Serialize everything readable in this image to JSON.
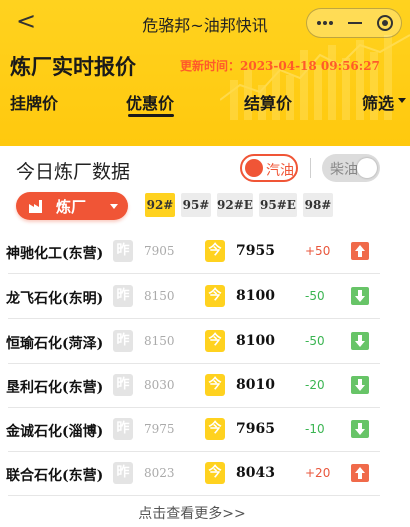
{
  "navbar": {
    "back_label": "<",
    "title": "危骆邦~油邦快讯"
  },
  "header": {
    "title": "炼厂实时报价",
    "update_time": "更新时间：2023-04-18 09:56:27"
  },
  "tabs": [
    {
      "label": "挂牌价",
      "active": false
    },
    {
      "label": "优惠价",
      "active": true
    },
    {
      "label": "结算价",
      "active": false
    },
    {
      "label": "筛选",
      "active": false
    }
  ],
  "section": {
    "title": "今日炼厂数据",
    "fuel_gasoline": "汽油",
    "fuel_diesel": "柴油",
    "selected_fuel": "汽油"
  },
  "refinery_select": {
    "label": "炼厂"
  },
  "grades": [
    {
      "label": "92#",
      "active": true
    },
    {
      "label": "95#",
      "active": false
    },
    {
      "label": "92#E",
      "active": false
    },
    {
      "label": "95#E",
      "active": false
    },
    {
      "label": "98#",
      "active": false
    }
  ],
  "badges": {
    "yesterday": "昨",
    "today": "今"
  },
  "rows": [
    {
      "name": "神驰化工(东营)",
      "yesterday": "7905",
      "today": "7955",
      "change": "+50",
      "direction": "up"
    },
    {
      "name": "龙飞石化(东明)",
      "yesterday": "8150",
      "today": "8100",
      "change": "-50",
      "direction": "down"
    },
    {
      "name": "恒瑜石化(菏泽)",
      "yesterday": "8150",
      "today": "8100",
      "change": "-50",
      "direction": "down"
    },
    {
      "name": "垦利石化(东营)",
      "yesterday": "8030",
      "today": "8010",
      "change": "-20",
      "direction": "down"
    },
    {
      "name": "金诚石化(淄博)",
      "yesterday": "7975",
      "today": "7965",
      "change": "-10",
      "direction": "down"
    },
    {
      "name": "联合石化(东营)",
      "yesterday": "8023",
      "today": "8043",
      "change": "+20",
      "direction": "up"
    }
  ],
  "footer": {
    "more_label": "点击查看更多>>"
  },
  "colors": {
    "header_yellow": "#ffd21f",
    "accent_red": "#f05536",
    "up_red": "#f06a4a",
    "down_green": "#67c467"
  }
}
